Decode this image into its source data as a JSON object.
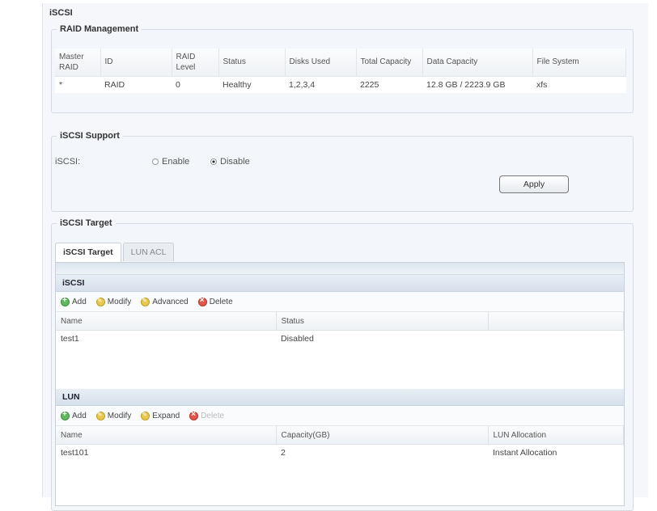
{
  "outer_title": "iSCSI",
  "raid": {
    "legend": "RAID Management",
    "headers": [
      "Master RAID",
      "ID",
      "RAID Level",
      "Status",
      "Disks Used",
      "Total Capacity",
      "Data Capacity",
      "File System"
    ],
    "rows": [
      [
        "*",
        "RAID",
        "0",
        "Healthy",
        "1,2,3,4",
        "2225",
        "12.8 GB / 2223.9 GB",
        "xfs"
      ]
    ]
  },
  "support": {
    "legend": "iSCSI Support",
    "label": "iSCSI:",
    "enable_label": "Enable",
    "disable_label": "Disable",
    "selected": "Disable",
    "apply_label": "Apply"
  },
  "target": {
    "legend": "iSCSI Target",
    "tabs": [
      "iSCSI Target",
      "LUN ACL"
    ],
    "iscsi_section": {
      "title": "iSCSI",
      "toolbar": [
        "Add",
        "Modify",
        "Advanced",
        "Delete"
      ],
      "headers": [
        "Name",
        "Status",
        ""
      ],
      "rows": [
        [
          "test1",
          "Disabled",
          ""
        ]
      ]
    },
    "lun_section": {
      "title": "LUN",
      "toolbar": [
        "Add",
        "Modify",
        "Expand",
        "Delete"
      ],
      "headers": [
        "Name",
        "Capacity(GB)",
        "LUN Allocation"
      ],
      "rows": [
        [
          "test101",
          "2",
          "Instant Allocation"
        ]
      ]
    }
  },
  "icons": {
    "add": "add-icon",
    "modify": "modify-icon",
    "advanced": "advanced-icon",
    "expand": "expand-icon",
    "delete": "delete-icon"
  },
  "colors": {
    "add": "#5fb85b",
    "modify": "#e9c84f",
    "delete": "#e2574c",
    "section_header": "#d6e0ec"
  }
}
